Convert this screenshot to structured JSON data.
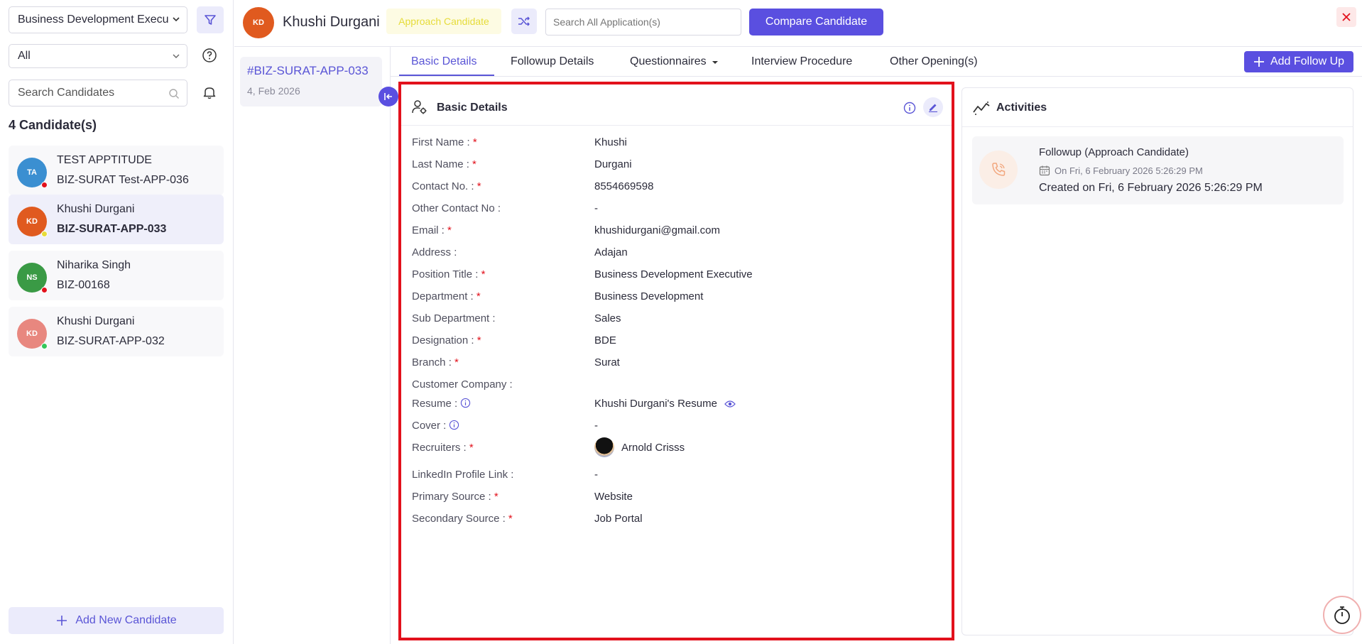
{
  "sidebar": {
    "position_filter": "Business Development Executive",
    "status_filter": "All",
    "search_placeholder": "Search Candidates",
    "candidate_count": "4 Candidate(s)",
    "candidates": [
      {
        "initials": "TA",
        "name": "TEST APPTITUDE",
        "code": "BIZ-SURAT Test-APP-036",
        "avatar_color": "#3b8fd1",
        "status_color": "#e2111c"
      },
      {
        "initials": "KD",
        "name": "Khushi Durgani",
        "code": "BIZ-SURAT-APP-033",
        "avatar_color": "#e05a1f",
        "status_color": "#e6dc3a"
      },
      {
        "initials": "NS",
        "name": "Niharika Singh",
        "code": "BIZ-00168",
        "avatar_color": "#3a9a45",
        "status_color": "#e2111c"
      },
      {
        "initials": "KD",
        "name": "Khushi Durgani",
        "code": "BIZ-SURAT-APP-032",
        "avatar_color": "#e8877f",
        "status_color": "#34c759"
      }
    ],
    "add_candidate_label": "Add New Candidate"
  },
  "header": {
    "initials": "KD",
    "name": "Khushi Durgani",
    "status_badge": "Approach Candidate",
    "search_placeholder": "Search All Application(s)",
    "compare_label": "Compare Candidate"
  },
  "application": {
    "code": "#BIZ-SURAT-APP-033",
    "date": "4, Feb 2026"
  },
  "tabs": [
    {
      "label": "Basic Details"
    },
    {
      "label": "Followup Details"
    },
    {
      "label": "Questionnaires"
    },
    {
      "label": "Interview Procedure"
    },
    {
      "label": "Other Opening(s)"
    }
  ],
  "add_followup_label": "Add Follow Up",
  "details": {
    "title": "Basic Details",
    "fields": [
      {
        "label": "First Name :",
        "required": true,
        "value": "Khushi"
      },
      {
        "label": "Last Name :",
        "required": true,
        "value": "Durgani"
      },
      {
        "label": "Contact No. :",
        "required": true,
        "value": "8554669598"
      },
      {
        "label": "Other Contact No :",
        "required": false,
        "value": "-"
      },
      {
        "label": "Email :",
        "required": true,
        "value": "khushidurgani@gmail.com"
      },
      {
        "label": "Address :",
        "required": false,
        "value": "Adajan"
      },
      {
        "label": "Position Title :",
        "required": true,
        "value": "Business Development Executive"
      },
      {
        "label": "Department :",
        "required": true,
        "value": "Business Development"
      },
      {
        "label": "Sub Department :",
        "required": false,
        "value": "Sales"
      },
      {
        "label": "Designation :",
        "required": true,
        "value": "BDE"
      },
      {
        "label": "Branch :",
        "required": true,
        "value": "Surat"
      },
      {
        "label": "Customer Company :",
        "required": false,
        "value": ""
      },
      {
        "label": "Resume :",
        "required": false,
        "value": "Khushi Durgani's Resume"
      },
      {
        "label": "Cover :",
        "required": false,
        "value": "-"
      },
      {
        "label": "Recruiters :",
        "required": true,
        "value": "Arnold Crisss"
      },
      {
        "label": "LinkedIn Profile Link :",
        "required": false,
        "value": "-"
      },
      {
        "label": "Primary Source :",
        "required": true,
        "value": "Website"
      },
      {
        "label": "Secondary Source :",
        "required": true,
        "value": "Job Portal"
      }
    ]
  },
  "activities": {
    "title": "Activities",
    "items": [
      {
        "title": "Followup (Approach Candidate)",
        "on": "On Fri, 6 February 2026 5:26:29 PM",
        "created": "Created on Fri, 6 February 2026 5:26:29 PM"
      }
    ]
  }
}
